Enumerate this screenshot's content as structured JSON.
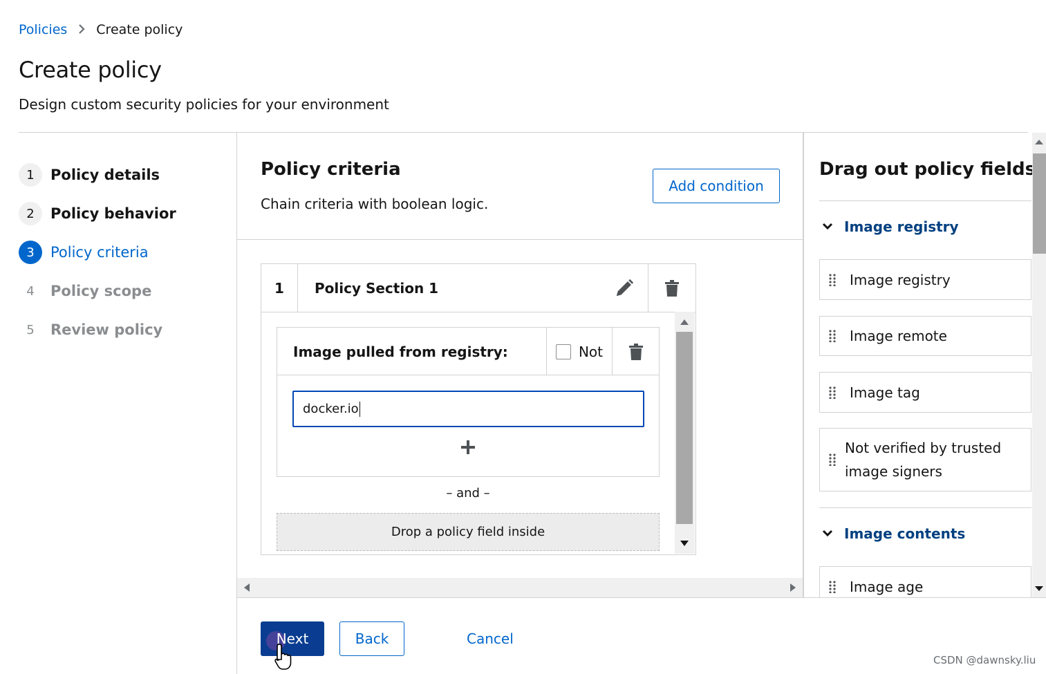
{
  "breadcrumb": {
    "parent": "Policies",
    "current": "Create policy"
  },
  "page": {
    "title": "Create policy",
    "description": "Design custom security policies for your environment"
  },
  "wizard_steps": [
    {
      "num": "1",
      "label": "Policy details",
      "state": "done"
    },
    {
      "num": "2",
      "label": "Policy behavior",
      "state": "done"
    },
    {
      "num": "3",
      "label": "Policy criteria",
      "state": "current"
    },
    {
      "num": "4",
      "label": "Policy scope",
      "state": "todo"
    },
    {
      "num": "5",
      "label": "Review policy",
      "state": "todo"
    }
  ],
  "criteria": {
    "title": "Policy criteria",
    "description": "Chain criteria with boolean logic.",
    "add_condition": "Add condition",
    "section": {
      "number": "1",
      "name": "Policy Section 1",
      "field": {
        "label": "Image pulled from registry:",
        "not_label": "Not",
        "value": "docker.io"
      },
      "and_separator": "– and –",
      "drop_zone": "Drop a policy field inside"
    }
  },
  "fields_panel": {
    "title": "Drag out policy fields",
    "groups": [
      {
        "name": "Image registry",
        "items": [
          "Image registry",
          "Image remote",
          "Image tag",
          "Not verified by trusted image signers"
        ]
      },
      {
        "name": "Image contents",
        "items": [
          "Image age"
        ]
      }
    ]
  },
  "footer": {
    "next": "Next",
    "back": "Back",
    "cancel": "Cancel"
  },
  "watermark": "CSDN @dawnsky.liu",
  "colors": {
    "accent": "#0066cc",
    "primary_button": "#0a3d91",
    "group_heading": "#004080"
  },
  "icons": [
    "chevron-right-icon",
    "pencil-icon",
    "trash-icon",
    "plus-icon",
    "chevron-down-icon",
    "drag-handle-icon",
    "pointer-cursor-icon"
  ]
}
